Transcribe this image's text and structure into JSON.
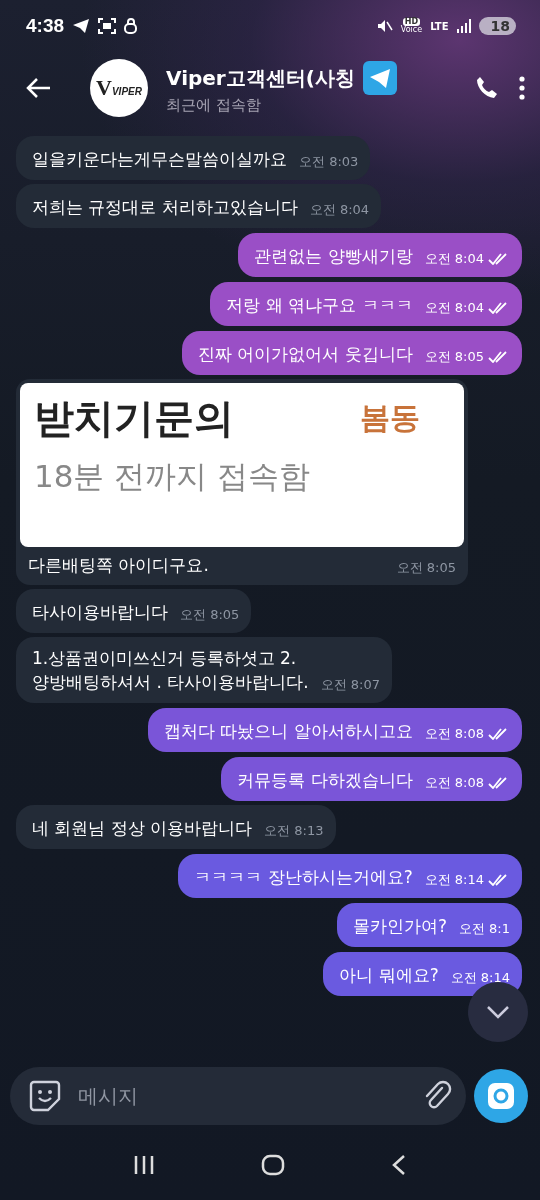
{
  "status_bar": {
    "time": "4:38",
    "hd": "HD",
    "voice": "Voice",
    "network": "LTE",
    "battery": "18"
  },
  "header": {
    "logo_mark": "V",
    "logo_text": "VIPER",
    "title": "Viper고객센터(사칭",
    "subtitle": "최근에 접속함"
  },
  "messages": [
    {
      "kind": "text",
      "outgoing": false,
      "text": "일을키운다는게무슨말씀이실까요",
      "time": "오전 8:03"
    },
    {
      "kind": "text",
      "outgoing": false,
      "text": "저희는 규정대로 처리하고있습니다",
      "time": "오전 8:04"
    },
    {
      "kind": "text",
      "outgoing": true,
      "text": "관련없는 양빵새기랑",
      "time": "오전 8:04",
      "read": true
    },
    {
      "kind": "text",
      "outgoing": true,
      "text": "저랑 왜 엮냐구요 ㅋㅋㅋ",
      "time": "오전 8:04",
      "read": true
    },
    {
      "kind": "text",
      "outgoing": true,
      "text": "진짜 어이가없어서 웃깁니다",
      "time": "오전 8:05",
      "read": true
    },
    {
      "kind": "shot",
      "outgoing": false,
      "shot_title": "받치기문의",
      "shot_status": "18분 전까지 접속함",
      "shot_sticker": "봄동",
      "text": "다른배팅쪽 아이디구요.",
      "time": "오전 8:05"
    },
    {
      "kind": "text",
      "outgoing": false,
      "text": "타사이용바랍니다",
      "time": "오전 8:05"
    },
    {
      "kind": "text",
      "outgoing": false,
      "text": "1.상품권이미쓰신거 등록하셧고 2.\n양방배팅하셔서 . 타사이용바랍니다.",
      "time": "오전 8:07"
    },
    {
      "kind": "text",
      "outgoing": true,
      "text": "캡처다 따놨으니 알아서하시고요",
      "time": "오전 8:08",
      "read": true
    },
    {
      "kind": "text",
      "outgoing": true,
      "text": "커뮤등록 다하겠습니다",
      "time": "오전 8:08",
      "read": true
    },
    {
      "kind": "text",
      "outgoing": false,
      "text": "네 회원님 정상 이용바랍니다",
      "time": "오전 8:13"
    },
    {
      "kind": "text",
      "outgoing": true,
      "text": "ㅋㅋㅋㅋ 장난하시는거에요?",
      "time": "오전 8:14",
      "read": true
    },
    {
      "kind": "text",
      "outgoing": true,
      "text": "몰카인가여?",
      "time": "오전 8:1",
      "read": false
    },
    {
      "kind": "text",
      "outgoing": true,
      "text": "아니 뭐에요?",
      "time": "오전 8:14",
      "read": false
    }
  ],
  "composer": {
    "placeholder": "메시지"
  }
}
